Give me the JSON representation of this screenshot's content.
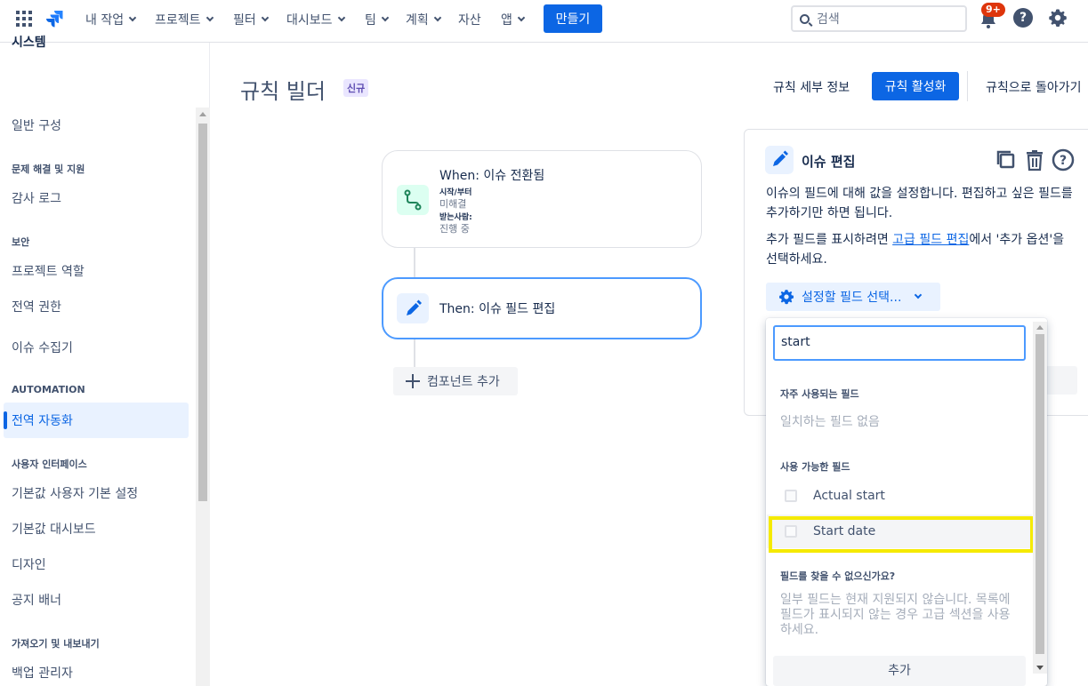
{
  "topnav": {
    "items": [
      {
        "label": "내 작업",
        "has_chevron": true
      },
      {
        "label": "프로젝트",
        "has_chevron": true
      },
      {
        "label": "필터",
        "has_chevron": true
      },
      {
        "label": "대시보드",
        "has_chevron": true
      },
      {
        "label": "팀",
        "has_chevron": true
      },
      {
        "label": "계획",
        "has_chevron": true
      },
      {
        "label": "자산",
        "has_chevron": false
      },
      {
        "label": "앱",
        "has_chevron": true
      }
    ],
    "create_label": "만들기",
    "search_placeholder": "검색",
    "notification_badge": "9+",
    "help_glyph": "?"
  },
  "sidebar": {
    "title": "시스템",
    "items": [
      {
        "label": "일반 구성"
      },
      {
        "header": "문제 해결 및 지원"
      },
      {
        "label": "감사 로그"
      },
      {
        "header": "보안"
      },
      {
        "label": "프로젝트 역할"
      },
      {
        "label": "전역 권한"
      },
      {
        "label": "이슈 수집기"
      },
      {
        "header": "AUTOMATION"
      },
      {
        "label": "전역 자동화",
        "active": true
      },
      {
        "header": "사용자 인터페이스"
      },
      {
        "label": "기본값 사용자 기본 설정"
      },
      {
        "label": "기본값 대시보드"
      },
      {
        "label": "디자인"
      },
      {
        "label": "공지 배너"
      },
      {
        "header": "가져오기 및 내보내기"
      },
      {
        "label": "백업 관리자"
      }
    ]
  },
  "header": {
    "title": "규칙 빌더",
    "badge": "신규",
    "details_link": "규칙 세부 정보",
    "activate_button": "규칙 활성화",
    "back_link": "규칙으로 돌아가기"
  },
  "flow": {
    "when": {
      "title": "When: 이슈 전환됨",
      "from_label": "시작/부터",
      "from_value": "미해결",
      "to_label": "받는사람:",
      "to_value": "진행 중"
    },
    "then": {
      "title": "Then: 이슈 필드 편집"
    },
    "add_component": "컴포넌트 추가"
  },
  "panel": {
    "title": "이슈 편집",
    "desc1": "이슈의 필드에 대해 값을 설정합니다. 편집하고 싶은 필드를 추가하기만 하면 됩니다.",
    "desc2_before": "추가 필드를 표시하려면 ",
    "desc2_link": "고급 필드 편집",
    "desc2_after": "에서 '추가 옵션'을 선택하세요.",
    "field_select_label": "설정할 필드 선택..."
  },
  "dropdown": {
    "search_value": "start",
    "frequent_header": "자주 사용되는 필드",
    "frequent_empty": "일치하는 필드 없음",
    "available_header": "사용 가능한 필드",
    "options": [
      {
        "label": "Actual start",
        "checked": false
      },
      {
        "label": "Start date",
        "checked": false,
        "highlighted": true
      }
    ],
    "missing_header": "필드를 찾을 수 없으신가요?",
    "missing_text": "일부 필드는 현재 지원되지 않습니다. 목록에 필드가 표시되지 않는 경우 고급 섹션을 사용하세요.",
    "add_button": "추가"
  },
  "colors": {
    "primary": "#0c66e4",
    "highlight_outline": "#f5ea00",
    "badge_red": "#de350b"
  }
}
